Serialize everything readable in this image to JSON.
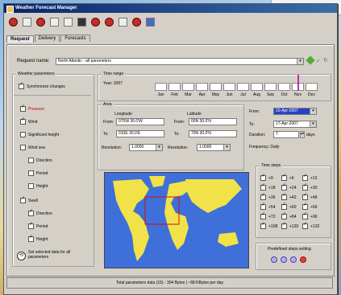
{
  "window": {
    "title": "Weather Forecast Manager"
  },
  "toolbar": {
    "icons": [
      "new-icon",
      "open-icon",
      "stop-icon",
      "copy-icon",
      "paste-icon",
      "save-icon",
      "cut-icon",
      "delete-icon",
      "settings-icon",
      "power-icon",
      "help-icon"
    ]
  },
  "tabs": [
    "Request",
    "Delivery",
    "Forecasts"
  ],
  "request": {
    "label": "Request name:",
    "value": "North Atlantic - all parameters"
  },
  "weather_params": {
    "title": "Weather parameters",
    "sync_label": "Synchronize changes",
    "items": [
      {
        "label": "Pressure",
        "checked": true,
        "red": true
      },
      {
        "label": "Wind",
        "checked": true
      },
      {
        "label": "Significant height",
        "checked": false
      },
      {
        "label": "Wind sea",
        "checked": false
      },
      {
        "label": "Direction",
        "checked": false,
        "sub": true
      },
      {
        "label": "Period",
        "checked": false,
        "sub": true
      },
      {
        "label": "Height",
        "checked": false,
        "sub": true
      },
      {
        "label": "Swell",
        "checked": true
      },
      {
        "label": "Direction",
        "checked": true,
        "sub": true
      },
      {
        "label": "Period",
        "checked": true,
        "sub": true
      },
      {
        "label": "Height",
        "checked": true,
        "sub": true
      }
    ],
    "defaults_label": "Set selected data for all parameters"
  },
  "timerange": {
    "title": "Time range",
    "year": "Year: 2007",
    "months": [
      "Jan",
      "Feb",
      "Mar",
      "Apr",
      "May",
      "Jun",
      "Jul",
      "Aug",
      "Sep",
      "Oct",
      "Nov",
      "Dec"
    ]
  },
  "area": {
    "title": "Area",
    "longitude": "Longitude",
    "latitude": "Latitude",
    "from_label": "From:",
    "to_label": "To:",
    "resolution_label": "Resolution:",
    "lon_from": "075W 30.0'W",
    "lon_to": "010E 30.0'E",
    "lat_from": "00N 30.0'N",
    "lat_to": "70N 30.0'N",
    "resolution1": "1.0000",
    "resolution2": "1.0000"
  },
  "timecontrols": {
    "from_label": "From:",
    "to_label": "To:",
    "duration_label": "Duration:",
    "from_value": "10-Apr-2007",
    "to_value": "17-Apr-2007",
    "duration_value": "7",
    "duration_unit": "days",
    "frequency": "Frequency: Daily"
  },
  "timesteps": {
    "title": "Time steps",
    "items": [
      "+0",
      "+6",
      "+12",
      "+18",
      "+24",
      "+30",
      "+36",
      "+42",
      "+48",
      "+54",
      "+60",
      "+66",
      "+72",
      "+84",
      "+96",
      "+108",
      "+120",
      "+132"
    ]
  },
  "settings": {
    "label": "Predefined steps setting"
  },
  "status": {
    "text": "Total parameters data (15) - 304 Bytes | ~68 KBytes per day"
  },
  "colors": {
    "title_start": "#0a246a",
    "title_end": "#3a6ea5",
    "accent_red": "#c00000",
    "map_ocean": "#3f6fd8",
    "map_land": "#f2e24a"
  }
}
